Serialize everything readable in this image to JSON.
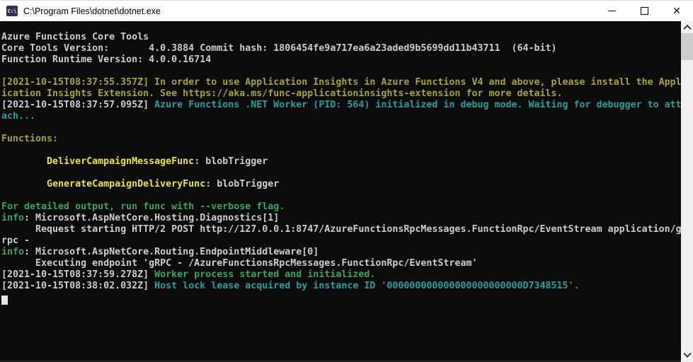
{
  "window": {
    "title": "C:\\Program Files\\dotnet\\dotnet.exe",
    "icon_label": "C:\\",
    "close_glyph": "✕"
  },
  "terminal": {
    "palette": {
      "gray": "#CCCCCC",
      "olive": "#A3A342",
      "yellow": "#E6E63C",
      "teal": "#2E9D9D",
      "green": "#3DA35C"
    },
    "lines": [
      [
        {
          "t": "Azure Functions Core Tools",
          "c": "gray"
        }
      ],
      [
        {
          "t": "Core Tools Version:       4.0.3884 Commit hash: 1806454fe9a717ea6a23aded9b5699dd11b43711  (64-bit)",
          "c": "gray"
        }
      ],
      [
        {
          "t": "Function Runtime Version: 4.0.0.16714",
          "c": "gray"
        }
      ],
      [],
      [
        {
          "t": "[2021-10-15T08:37:55.357Z] In order to use Application Insights in Azure Functions V4 and above, please install the Appl",
          "c": "olive"
        }
      ],
      [
        {
          "t": "ication Insights Extension. See https://aka.ms/func-applicationinsights-extension for more details.",
          "c": "olive"
        }
      ],
      [
        {
          "t": "[2021-10-15T08:37:57.095Z] ",
          "c": "gray"
        },
        {
          "t": "Azure Functions .NET Worker (PID: 564) initialized in debug mode. Waiting for debugger to att",
          "c": "teal"
        }
      ],
      [
        {
          "t": "ach...",
          "c": "teal"
        }
      ],
      [],
      [
        {
          "t": "Functions:",
          "c": "olive"
        }
      ],
      [],
      [
        {
          "t": "        ",
          "c": "gray"
        },
        {
          "t": "DeliverCampaignMessageFunc",
          "c": "yellow"
        },
        {
          "t": ": blobTrigger",
          "c": "gray"
        }
      ],
      [],
      [
        {
          "t": "        ",
          "c": "gray"
        },
        {
          "t": "GenerateCampaignDeliveryFunc",
          "c": "yellow"
        },
        {
          "t": ": blobTrigger",
          "c": "gray"
        }
      ],
      [],
      [
        {
          "t": "For detailed output, run func with --verbose flag.",
          "c": "green"
        }
      ],
      [
        {
          "t": "info",
          "c": "green"
        },
        {
          "t": ": Microsoft.AspNetCore.Hosting.Diagnostics[1]",
          "c": "gray"
        }
      ],
      [
        {
          "t": "      Request starting HTTP/2 POST http://127.0.0.1:8747/AzureFunctionsRpcMessages.FunctionRpc/EventStream application/g",
          "c": "gray"
        }
      ],
      [
        {
          "t": "rpc -",
          "c": "gray"
        }
      ],
      [
        {
          "t": "info",
          "c": "green"
        },
        {
          "t": ": Microsoft.AspNetCore.Routing.EndpointMiddleware[0]",
          "c": "gray"
        }
      ],
      [
        {
          "t": "      Executing endpoint 'gRPC - /AzureFunctionsRpcMessages.FunctionRpc/EventStream'",
          "c": "gray"
        }
      ],
      [
        {
          "t": "[2021-10-15T08:37:59.278Z] ",
          "c": "gray"
        },
        {
          "t": "Worker process started and initialized.",
          "c": "green"
        }
      ],
      [
        {
          "t": "[2021-10-15T08:38:02.032Z] ",
          "c": "gray"
        },
        {
          "t": "Host lock lease acquired by instance ID '000000000000000000000000D7348515'.",
          "c": "teal"
        }
      ]
    ]
  }
}
